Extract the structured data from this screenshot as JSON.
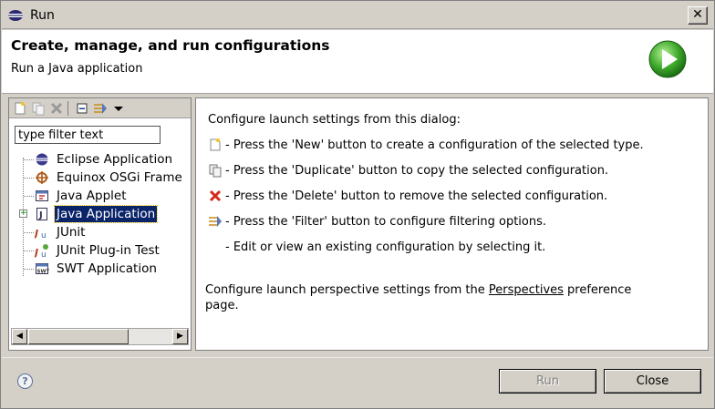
{
  "window": {
    "title": "Run",
    "close_glyph": "✕"
  },
  "banner": {
    "title": "Create, manage, and run configurations",
    "subtitle": "Run a Java application",
    "icon": "run-icon",
    "accent": "#2f9a1f"
  },
  "toolbar": {
    "buttons": [
      "new-config-icon",
      "duplicate-icon",
      "delete-icon",
      "collapse-all-icon",
      "filter-icon",
      "view-menu-icon"
    ]
  },
  "filter": {
    "value": "type filter text"
  },
  "tree": {
    "items": [
      {
        "label": "Eclipse Application",
        "icon": "eclipse-icon"
      },
      {
        "label": "Equinox OSGi Frame",
        "icon": "osgi-icon"
      },
      {
        "label": "Java Applet",
        "icon": "applet-icon"
      },
      {
        "label": "Java Application",
        "icon": "java-app-icon",
        "selected": true,
        "expander": "+"
      },
      {
        "label": "JUnit",
        "icon": "junit-icon"
      },
      {
        "label": "JUnit Plug-in Test",
        "icon": "junit-plugin-icon"
      },
      {
        "label": "SWT Application",
        "icon": "swt-icon"
      }
    ],
    "selection_color": "#0a246a"
  },
  "scrollbar": {
    "left_arrow": "◀",
    "right_arrow": "▶"
  },
  "info": {
    "intro": "Configure launch settings from this dialog:",
    "lines": [
      {
        "icon": "new-config-icon",
        "text": "- Press the 'New' button to create a configuration of the selected type."
      },
      {
        "icon": "duplicate-icon",
        "text": "- Press the 'Duplicate' button to copy the selected configuration."
      },
      {
        "icon": "delete-icon",
        "text": "- Press the 'Delete' button to remove the selected configuration."
      },
      {
        "icon": "filter-icon",
        "text": "- Press the 'Filter' button to configure filtering options."
      },
      {
        "icon": "",
        "text": "- Edit or view an existing configuration by selecting it."
      }
    ],
    "perspective_prefix": "Configure launch perspective settings from the ",
    "perspective_link": "Perspectives",
    "perspective_suffix": " preference",
    "perspective_line2": "page."
  },
  "footer": {
    "help_glyph": "?",
    "run_label": "Run",
    "close_label": "Close"
  }
}
